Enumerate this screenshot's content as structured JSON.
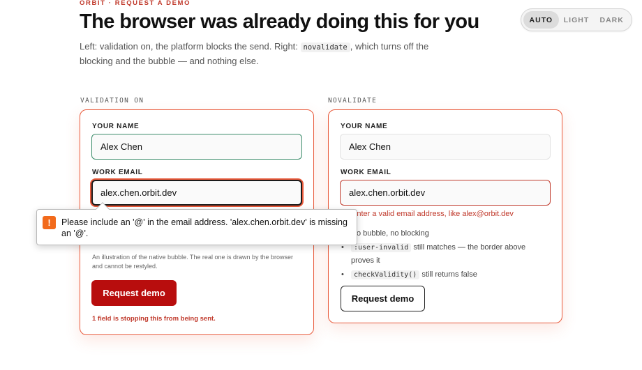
{
  "header": {
    "eyebrow": "ORBIT · REQUEST A DEMO",
    "title": "The browser was already doing this for you",
    "subtitle_part1": "Left: validation on, the platform blocks the send. Right: ",
    "subtitle_code": "novalidate",
    "subtitle_part2": ", which turns off the blocking and the bubble — and nothing else."
  },
  "theme_toggle": {
    "options": [
      "AUTO",
      "LIGHT",
      "DARK"
    ],
    "selected": "AUTO"
  },
  "left_panel": {
    "label": "VALIDATION ON",
    "name_label": "YOUR NAME",
    "name_value": "Alex Chen",
    "email_label": "WORK EMAIL",
    "email_value": "alex.chen.orbit.dev",
    "bubble_icon": "!",
    "bubble_message": "Please include an '@' in the email address. 'alex.chen.orbit.dev' is missing an '@'.",
    "bubble_note": "An illustration of the native bubble. The real one is drawn by the browser and cannot be restyled.",
    "submit_label": "Request demo",
    "status": "1 field is stopping this from being sent."
  },
  "right_panel": {
    "label": "NOVALIDATE",
    "name_label": "YOUR NAME",
    "name_value": "Alex Chen",
    "email_label": "WORK EMAIL",
    "email_value": "alex.chen.orbit.dev",
    "error": "Enter a valid email address, like alex@orbit.dev",
    "bullet1": "No bubble, no blocking",
    "bullet2_code": ":user-invalid",
    "bullet2_text": " still matches — the border above proves it",
    "bullet3_code": "checkValidity()",
    "bullet3_text": " still returns false",
    "submit_label": "Request demo"
  },
  "colors": {
    "accent": "#e8593a",
    "primary_button": "#b80d0d",
    "error_text": "#c0392b",
    "valid_border": "#3c8d6b",
    "warning_icon": "#f26a1b"
  }
}
